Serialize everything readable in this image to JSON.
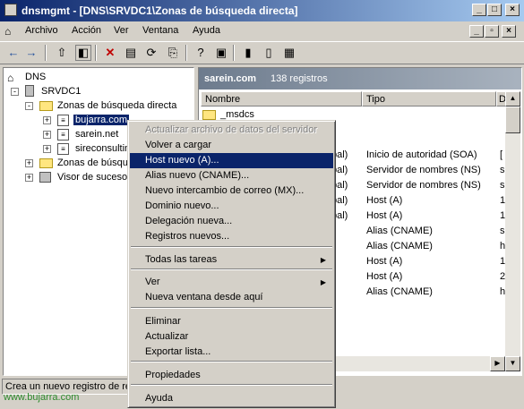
{
  "window": {
    "title": "dnsmgmt - [DNS\\SRVDC1\\Zonas de búsqueda directa]"
  },
  "menubar": [
    "Archivo",
    "Acción",
    "Ver",
    "Ventana",
    "Ayuda"
  ],
  "tree": {
    "root": "DNS",
    "server": "SRVDC1",
    "forward_zones": "Zonas de búsqueda directa",
    "zones": [
      "bujarra.com",
      "sarein.net",
      "sireconsultin"
    ],
    "reverse_zones": "Zonas de búsqu",
    "event_viewer": "Visor de sucesos"
  },
  "right": {
    "zone_name": "sarein.com",
    "record_count": "138 registros",
    "columns": [
      "Nombre",
      "Tipo",
      "D"
    ],
    "first_row_name": "_msdcs",
    "rows": [
      {
        "name": "pal)",
        "type": "Inicio de autoridad (SOA)",
        "data": "["
      },
      {
        "name": "pal)",
        "type": "Servidor de nombres (NS)",
        "data": "s"
      },
      {
        "name": "pal)",
        "type": "Servidor de nombres (NS)",
        "data": "s"
      },
      {
        "name": "pal)",
        "type": "Host (A)",
        "data": "1"
      },
      {
        "name": "pal)",
        "type": "Host (A)",
        "data": "1"
      },
      {
        "name": "",
        "type": "Alias (CNAME)",
        "data": "s"
      },
      {
        "name": "",
        "type": "Alias (CNAME)",
        "data": "h"
      },
      {
        "name": "",
        "type": "Host (A)",
        "data": "1"
      },
      {
        "name": "",
        "type": "Host (A)",
        "data": "2"
      },
      {
        "name": "",
        "type": "Alias (CNAME)",
        "data": "h"
      }
    ]
  },
  "context_menu": {
    "items": [
      {
        "label": "Actualizar archivo de datos del servidor",
        "disabled": true
      },
      {
        "label": "Volver a cargar"
      },
      {
        "label": "Host nuevo (A)...",
        "highlighted": true
      },
      {
        "label": "Alias nuevo (CNAME)..."
      },
      {
        "label": "Nuevo intercambio de correo (MX)..."
      },
      {
        "label": "Dominio nuevo..."
      },
      {
        "label": "Delegación nueva..."
      },
      {
        "label": "Registros nuevos..."
      },
      {
        "label": "Todas las tareas",
        "submenu": true
      },
      {
        "label": "Ver",
        "submenu": true
      },
      {
        "label": "Nueva ventana desde aquí"
      },
      {
        "label": "Eliminar"
      },
      {
        "label": "Actualizar"
      },
      {
        "label": "Exportar lista..."
      },
      {
        "label": "Propiedades"
      },
      {
        "label": "Ayuda"
      }
    ]
  },
  "status_bar": "Crea un nuevo registro de re",
  "watermark": "www.bujarra.com",
  "colors": {
    "title_start": "#0a246a",
    "title_end": "#a6caf0",
    "highlight": "#0a246a",
    "face": "#d4d0c8"
  }
}
